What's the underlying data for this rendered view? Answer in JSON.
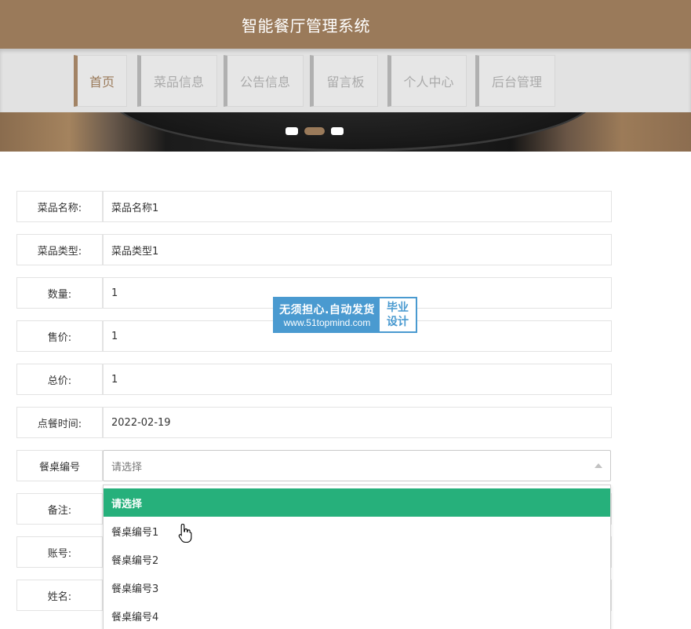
{
  "header": {
    "title": "智能餐厅管理系统"
  },
  "nav": {
    "items": [
      {
        "label": "首页"
      },
      {
        "label": "菜品信息"
      },
      {
        "label": "公告信息"
      },
      {
        "label": "留言板"
      },
      {
        "label": "个人中心"
      },
      {
        "label": "后台管理"
      }
    ],
    "active_index": 0
  },
  "carousel": {
    "slide_count": 3,
    "active_index": 1
  },
  "form": {
    "fields": [
      {
        "label": "菜品名称:",
        "value": "菜品名称1"
      },
      {
        "label": "菜品类型:",
        "value": "菜品类型1"
      },
      {
        "label": "数量:",
        "value": "1"
      },
      {
        "label": "售价:",
        "value": "1"
      },
      {
        "label": "总价:",
        "value": "1"
      },
      {
        "label": "点餐时间:",
        "value": "2022-02-19"
      }
    ],
    "table_select": {
      "label": "餐桌编号",
      "value": "请选择",
      "options": [
        "请选择",
        "餐桌编号1",
        "餐桌编号2",
        "餐桌编号3",
        "餐桌编号4"
      ],
      "highlighted_index": 0
    },
    "hidden_fields": [
      {
        "label": "备注:"
      },
      {
        "label": "账号:"
      },
      {
        "label": "姓名:"
      }
    ]
  },
  "watermark": {
    "line1": "无须担心.自动发货",
    "line2": "www.51topmind.com",
    "right1": "毕业",
    "right2": "设计"
  },
  "colors": {
    "brand": "#9a7a5a",
    "nav_bg": "#e2e2e2",
    "option_highlight": "#26b07b",
    "watermark": "#4a9ad0"
  }
}
